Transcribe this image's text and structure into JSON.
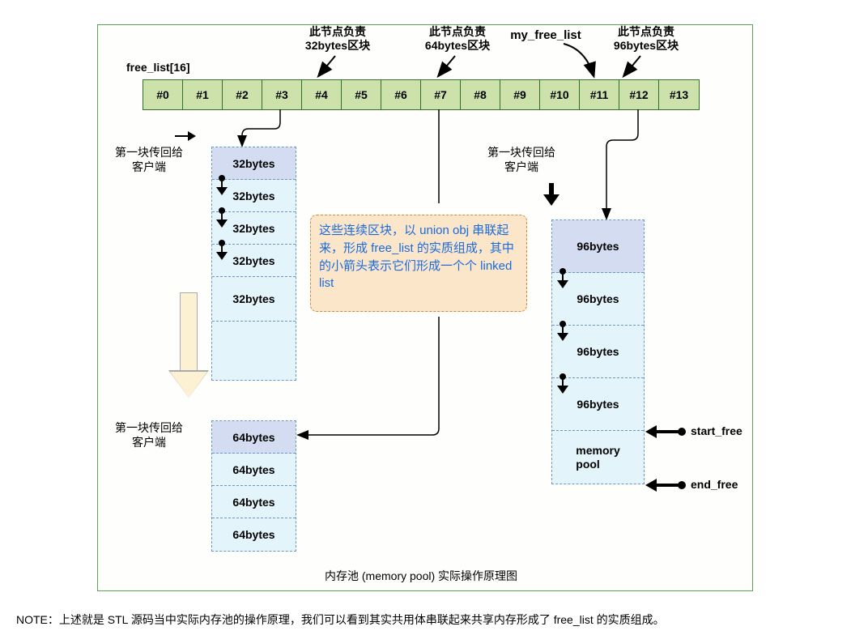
{
  "title": "free_list[16]",
  "topnotes": {
    "n32": "此节点负责\n32bytes区块",
    "n64": "此节点负责\n64bytes区块",
    "n96": "此节点负责\n96bytes区块",
    "my": "my_free_list"
  },
  "cells": [
    "#0",
    "#1",
    "#2",
    "#3",
    "#4",
    "#5",
    "#6",
    "#7",
    "#8",
    "#9",
    "#10",
    "#11",
    "#12",
    "#13"
  ],
  "return_label": "第一块传回给\n客户端",
  "col32": [
    "32bytes",
    "32bytes",
    "32bytes",
    "32bytes",
    "32bytes"
  ],
  "col64": [
    "64bytes",
    "64bytes",
    "64bytes",
    "64bytes"
  ],
  "col96": [
    "96bytes",
    "96bytes",
    "96bytes",
    "96bytes",
    "memory\npool"
  ],
  "center_note": "这些连续区块，以 union obj 串联起来，形成 free_list 的实质组成，其中的小箭头表示它们形成一个个 linked list",
  "right_labels": {
    "start": "start_free",
    "end": "end_free"
  },
  "caption": "内存池 (memory pool) 实际操作原理图",
  "bottom_note": "NOTE：上述就是 STL 源码当中实际内存池的操作原理，我们可以看到其实共用体串联起来共享内存形成了 free_list 的实质组成。"
}
